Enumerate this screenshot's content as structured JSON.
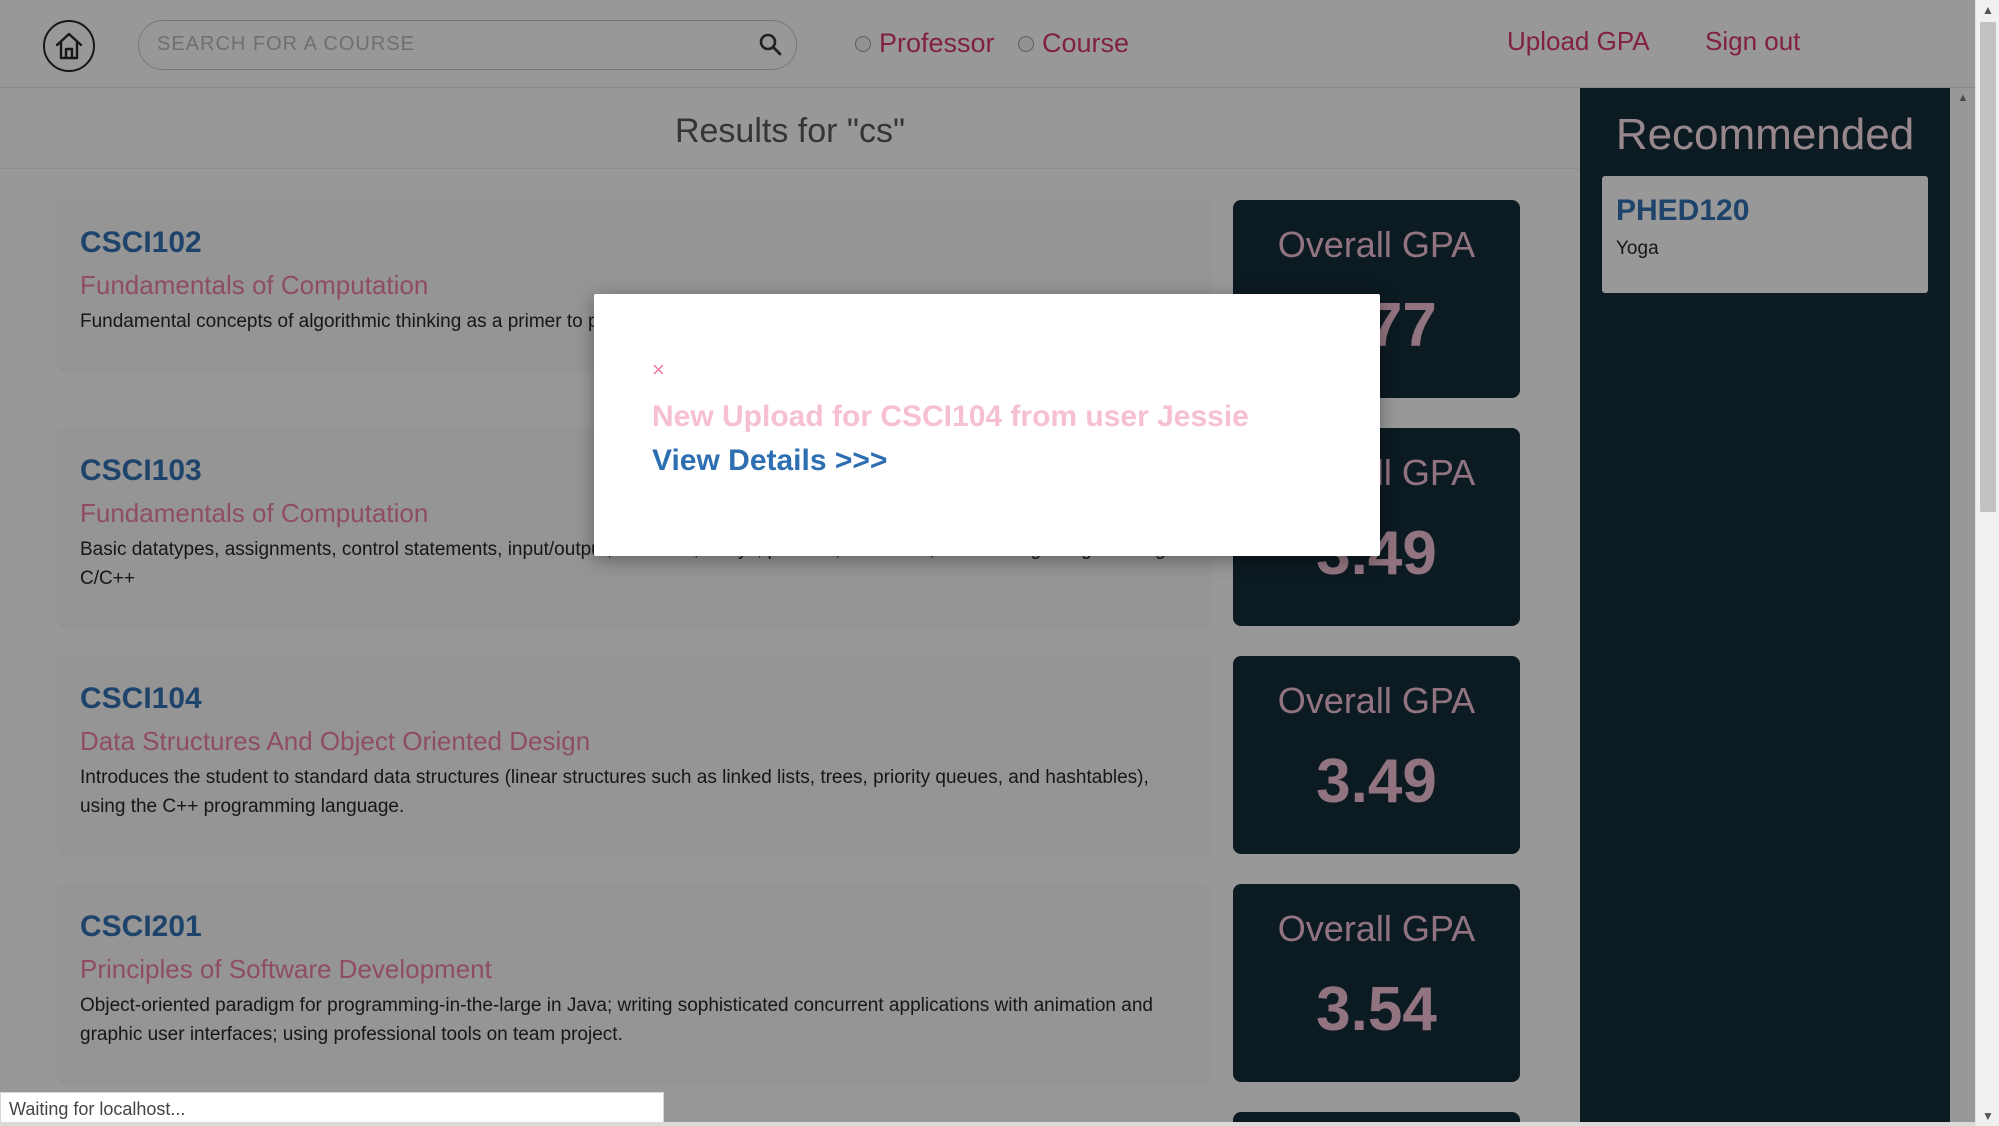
{
  "header": {
    "search_placeholder": "SEARCH FOR A COURSE",
    "radio_professor": "Professor",
    "radio_course": "Course",
    "upload_gpa": "Upload GPA",
    "sign_out": "Sign out"
  },
  "results": {
    "title": "Results for \"cs\"",
    "courses": [
      {
        "code": "CSCI102",
        "name": "Fundamentals of Computation",
        "description": "Fundamental concepts of algorithmic thinking as a primer to programming. Introduction to C++.",
        "gpa_label": "Overall GPA",
        "gpa": "3.77"
      },
      {
        "code": "CSCI103",
        "name": "Fundamentals of Computation",
        "description": "Basic datatypes, assignments, control statements, input/output, functions, arrays, pointers, structures, file handling. Programming in C/C++",
        "gpa_label": "Overall GPA",
        "gpa": "3.49"
      },
      {
        "code": "CSCI104",
        "name": "Data Structures And Object Oriented Design",
        "description": "Introduces the student to standard data structures (linear structures such as linked lists, trees, priority queues, and hashtables), using the C++ programming language.",
        "gpa_label": "Overall GPA",
        "gpa": "3.49"
      },
      {
        "code": "CSCI201",
        "name": "Principles of Software Development",
        "description": "Object-oriented paradigm for programming-in-the-large in Java; writing sophisticated concurrent applications with animation and graphic user interfaces; using professional tools on team project.",
        "gpa_label": "Overall GPA",
        "gpa": "3.54"
      }
    ]
  },
  "sidebar": {
    "title": "Recommended",
    "items": [
      {
        "code": "PHED120",
        "name": "Yoga"
      }
    ]
  },
  "modal": {
    "close": "×",
    "message": "New Upload for CSCI104 from user Jessie",
    "link": "View Details >>>"
  },
  "status": {
    "text": "Waiting for localhost..."
  },
  "icons": {
    "home": "home-icon",
    "search": "search-icon"
  }
}
